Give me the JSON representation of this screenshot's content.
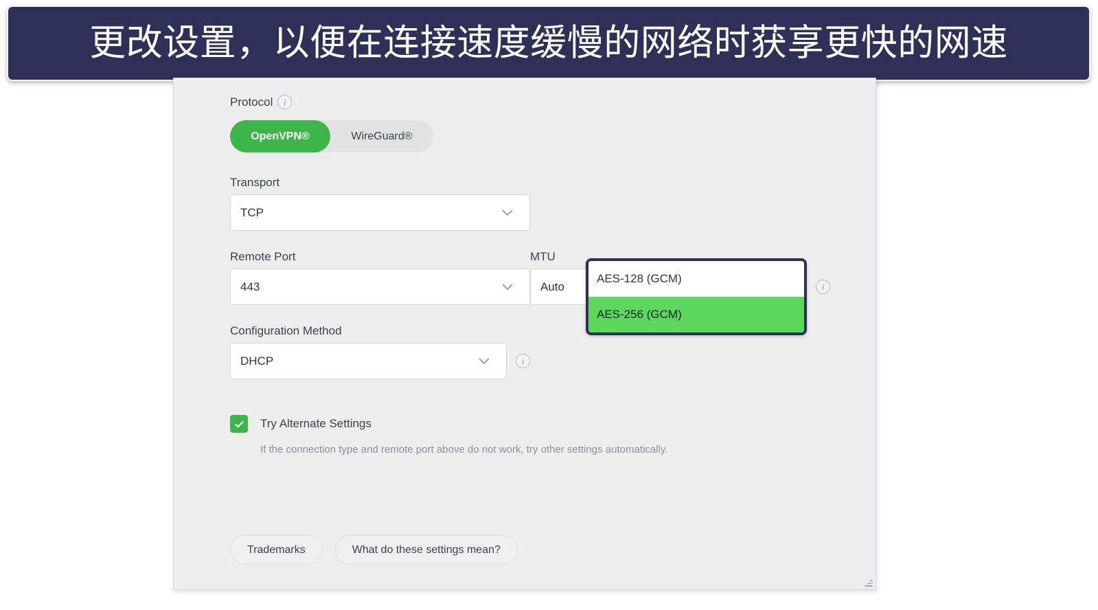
{
  "banner": {
    "text": "更改设置，以便在连接速度缓慢的网络时获享更快的网速",
    "background": "#2e3058",
    "text_color": "#ffffff"
  },
  "colors": {
    "accent_green": "#3cb54a",
    "dropdown_highlight_green": "#5bd75b",
    "panel_background": "#ededed",
    "label_text": "#3c3f50",
    "muted_text": "#8e9099"
  },
  "panel": {
    "protocol": {
      "label": "Protocol",
      "info_icon": "info-icon",
      "options": [
        {
          "label": "OpenVPN®",
          "active": true
        },
        {
          "label": "WireGuard®",
          "active": false
        }
      ]
    },
    "fields": {
      "transport": {
        "label": "Transport",
        "value": "TCP",
        "chevron_icon": "chevron-down-icon"
      },
      "remote_port": {
        "label": "Remote Port",
        "value": "443",
        "chevron_icon": "chevron-down-icon"
      },
      "configuration_method": {
        "label": "Configuration Method",
        "value": "DHCP",
        "chevron_icon": "chevron-down-icon",
        "info_icon": "info-icon"
      },
      "mtu": {
        "label": "MTU",
        "value": "Auto",
        "chevron_icon": "chevron-down-icon",
        "info_icon": "info-icon"
      }
    },
    "cipher_dropdown": {
      "open": true,
      "options": [
        {
          "label": "AES-128 (GCM)",
          "selected": false
        },
        {
          "label": "AES-256 (GCM)",
          "selected": true
        }
      ]
    },
    "try_alternate": {
      "label": "Try Alternate Settings",
      "checked": true,
      "check_icon": "check-icon",
      "help_text": "If the connection type and remote port above do not work, try other settings automatically."
    },
    "footer": {
      "trademarks_label": "Trademarks",
      "settings_help_label": "What do these settings mean?"
    },
    "resize_grip_icon": "resize-grip-icon"
  }
}
